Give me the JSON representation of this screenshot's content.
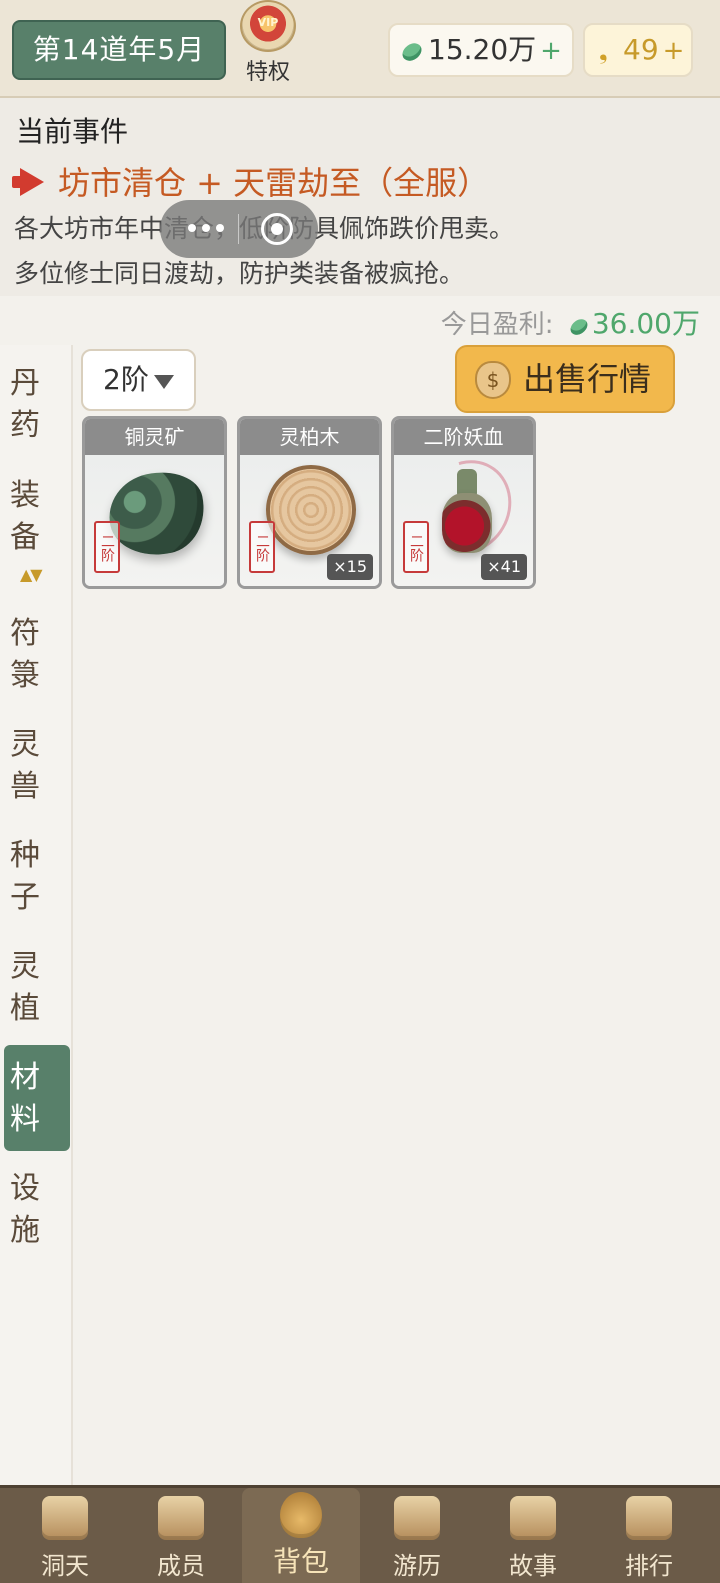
{
  "header": {
    "date_label": "第14道年5月",
    "privilege_badge_text": "VIP",
    "privilege_label": "特权",
    "jade_amount": "15.20万",
    "jade_plus": "+",
    "gold_amount": "49",
    "gold_plus": "+"
  },
  "event": {
    "section_title": "当前事件",
    "headline": "坊市清仓 + 天雷劫至（全服）",
    "line1": "各大坊市年中清仓，低阶防具佩饰跌价甩卖。",
    "line2": "多位修士同日渡劫，防护类装备被疯抢。"
  },
  "profit": {
    "label": "今日盈利: ",
    "value": "36.00万"
  },
  "sidebar": {
    "items": [
      {
        "label": "丹药",
        "active": false
      },
      {
        "label": "装备",
        "active": false
      },
      {
        "label": "符箓",
        "active": false
      },
      {
        "label": "灵兽",
        "active": false
      },
      {
        "label": "种子",
        "active": false
      },
      {
        "label": "灵植",
        "active": false
      },
      {
        "label": "材料",
        "active": true
      },
      {
        "label": "设施",
        "active": false
      }
    ],
    "sort_indicator": "▲▼"
  },
  "toolbar": {
    "tier_value": "2阶",
    "sell_button_label": "出售行情"
  },
  "items": [
    {
      "name": "铜灵矿",
      "tier_stamp": "二阶",
      "quantity": ""
    },
    {
      "name": "灵柏木",
      "tier_stamp": "二阶",
      "quantity": "×15"
    },
    {
      "name": "二阶妖血",
      "tier_stamp": "二阶",
      "quantity": "×41"
    }
  ],
  "bottom_nav": {
    "items": [
      {
        "label": "洞天",
        "icon": "cave-icon",
        "active": false
      },
      {
        "label": "成员",
        "icon": "members-icon",
        "active": false
      },
      {
        "label": "背包",
        "icon": "bag-icon",
        "active": true
      },
      {
        "label": "游历",
        "icon": "travel-icon",
        "active": false
      },
      {
        "label": "故事",
        "icon": "book-icon",
        "active": false
      },
      {
        "label": "排行",
        "icon": "ranking-icon",
        "active": false
      }
    ]
  },
  "colors": {
    "accent_green": "#58806a",
    "event_orange": "#c55a23",
    "sell_button": "#f2b84c",
    "nav_bar": "#6b5b48"
  }
}
